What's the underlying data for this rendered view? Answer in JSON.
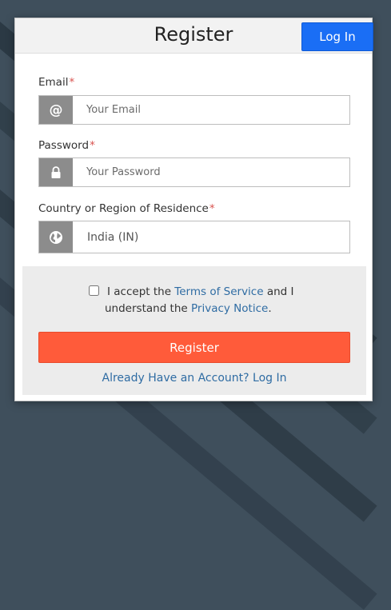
{
  "modal": {
    "title": "Register",
    "login_button": "Log In"
  },
  "email": {
    "label": "Email",
    "required_mark": "*",
    "placeholder": "Your Email",
    "icon": "at-icon"
  },
  "password": {
    "label": "Password",
    "required_mark": "*",
    "placeholder": "Your Password",
    "icon": "lock-icon"
  },
  "country": {
    "label": "Country or Region of Residence",
    "required_mark": "*",
    "value": "India (IN)",
    "icon": "globe-icon"
  },
  "terms": {
    "checked": false,
    "text_before": "I accept the ",
    "terms_link": "Terms of Service",
    "text_middle": " and I",
    "text_line2": "understand the ",
    "privacy_link": "Privacy Notice",
    "text_end": "."
  },
  "register_button": "Register",
  "already_link": "Already Have an Account? Log In",
  "colors": {
    "login_button": "#1a6ef5",
    "register_button": "#ff5b3a",
    "link": "#2f6ca3",
    "required": "#d9534f",
    "addon": "#8c8c8c"
  }
}
